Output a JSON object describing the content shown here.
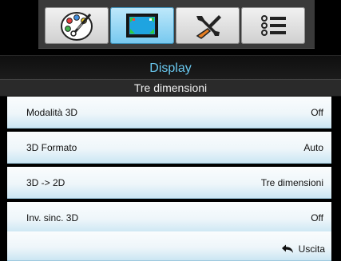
{
  "tabs": [
    {
      "icon": "palette-icon",
      "active": false
    },
    {
      "icon": "display-icon",
      "active": true
    },
    {
      "icon": "tools-icon",
      "active": false
    },
    {
      "icon": "list-icon",
      "active": false
    }
  ],
  "header": {
    "title": "Display",
    "subtitle": "Tre dimensioni"
  },
  "rows": [
    {
      "label": "Modalità 3D",
      "value": "Off"
    },
    {
      "label": "3D Formato",
      "value": "Auto"
    },
    {
      "label": "3D -> 2D",
      "value": "Tre dimensioni"
    },
    {
      "label": "Inv. sinc. 3D",
      "value": "Off"
    }
  ],
  "exit": {
    "label": "Uscita",
    "icon": "return-arrow-icon"
  },
  "colors": {
    "accent": "#69c8ef",
    "row_bg": "#eef6fa",
    "background": "#000000"
  }
}
